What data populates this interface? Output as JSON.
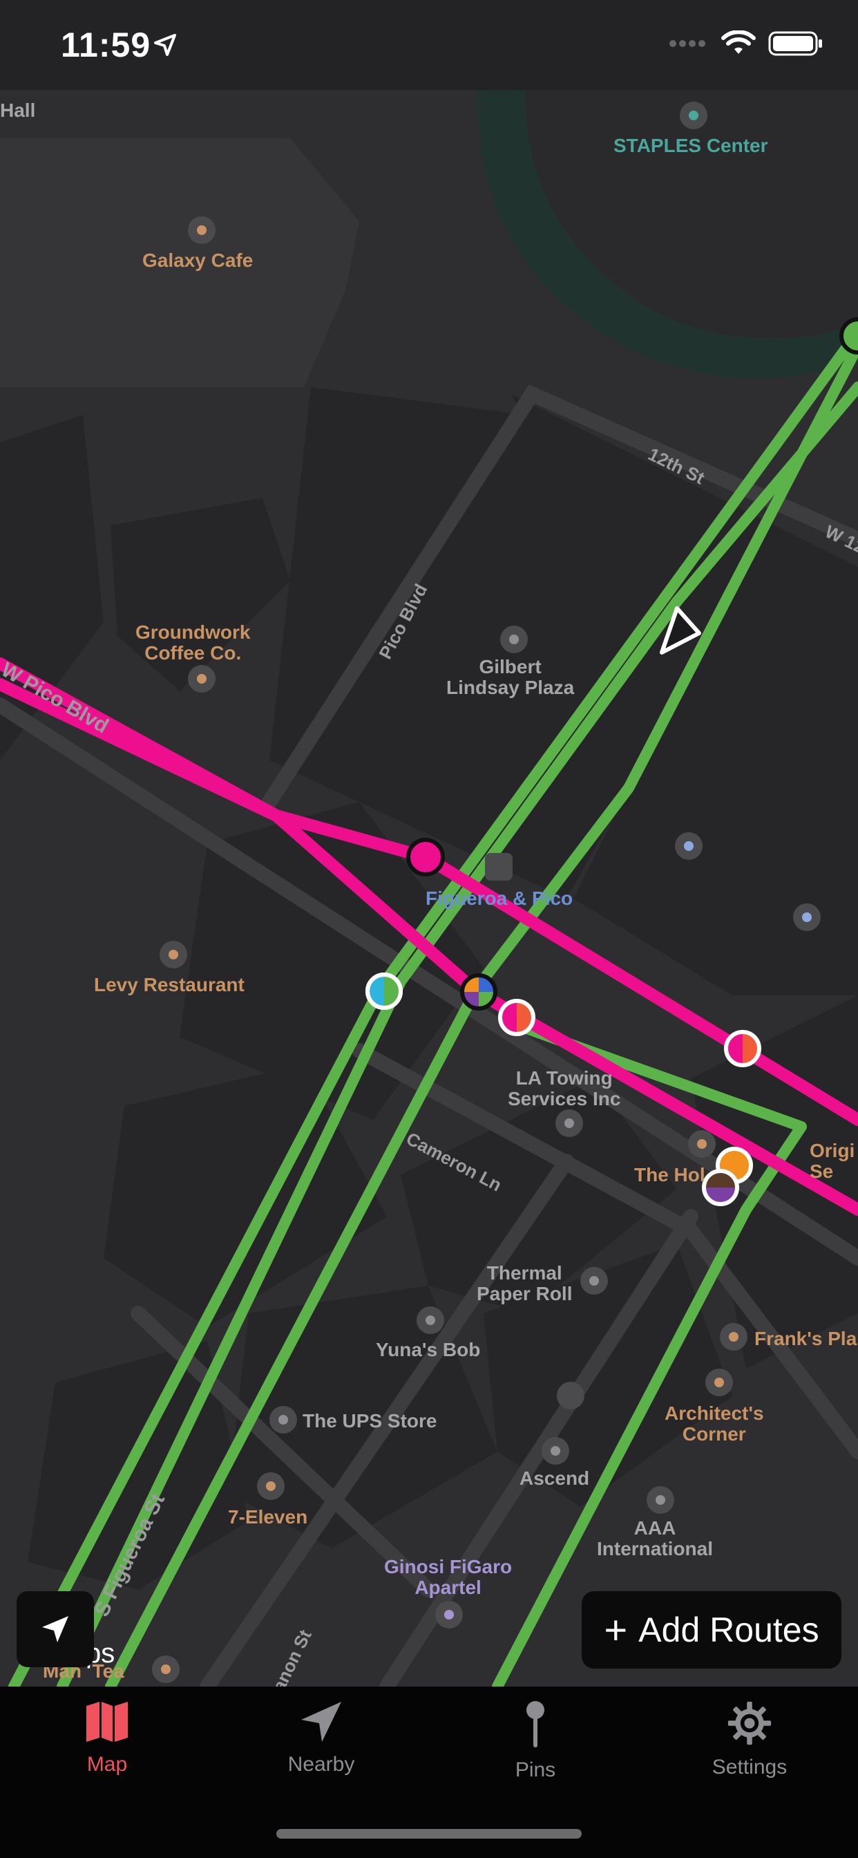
{
  "status_bar": {
    "time": "11:59"
  },
  "map": {
    "pois": [
      {
        "name": "Hall",
        "cls": "poi-gray"
      },
      {
        "name": "STAPLES Center",
        "cls": "poi-teal"
      },
      {
        "name": "Galaxy Cafe",
        "cls": "poi-orange"
      },
      {
        "name": "Groundwork\nCoffee Co.",
        "cls": "poi-orange"
      },
      {
        "name": "Gilbert\nLindsay Plaza",
        "cls": "poi-gray"
      },
      {
        "name": "Figueroa & Pico",
        "cls": "poi-blue"
      },
      {
        "name": "Levy Restaurant",
        "cls": "poi-orange"
      },
      {
        "name": "LA Towing\nServices Inc",
        "cls": "poi-gray"
      },
      {
        "name": "The Hol",
        "cls": "poi-orange"
      },
      {
        "name": "Origi\nSe",
        "cls": "poi-orange"
      },
      {
        "name": "Thermal\nPaper Roll",
        "cls": "poi-gray"
      },
      {
        "name": "Yuna's Bob",
        "cls": "poi-gray"
      },
      {
        "name": "Frank's Pla",
        "cls": "poi-orange"
      },
      {
        "name": "The UPS Store",
        "cls": "poi-gray"
      },
      {
        "name": "Architect's\nCorner",
        "cls": "poi-orange"
      },
      {
        "name": "Ascend",
        "cls": "poi-gray"
      },
      {
        "name": "7-Eleven",
        "cls": "poi-orange"
      },
      {
        "name": "AAA\nInternational",
        "cls": "poi-gray"
      },
      {
        "name": "Ginosi FiGaro\nApartel",
        "cls": "poi-purple"
      },
      {
        "name": "Man  Tea",
        "cls": "poi-orange"
      }
    ],
    "streets": [
      {
        "name": "12th St"
      },
      {
        "name": "W 12"
      },
      {
        "name": "Pico Blvd"
      },
      {
        "name": "W Pico Blvd"
      },
      {
        "name": "Cameron Ln"
      },
      {
        "name": "S Figueroa St"
      },
      {
        "name": "anon St"
      }
    ],
    "route_colors": {
      "green": "#5cb34a",
      "magenta": "#ee0f8f"
    },
    "legal_text": "ps"
  },
  "actions": {
    "add_routes_label": "Add Routes"
  },
  "tabs": [
    {
      "label": "Map",
      "icon": "map-icon",
      "active": true
    },
    {
      "label": "Nearby",
      "icon": "location-arrow-icon",
      "active": false
    },
    {
      "label": "Pins",
      "icon": "pin-icon",
      "active": false
    },
    {
      "label": "Settings",
      "icon": "gear-icon",
      "active": false
    }
  ]
}
